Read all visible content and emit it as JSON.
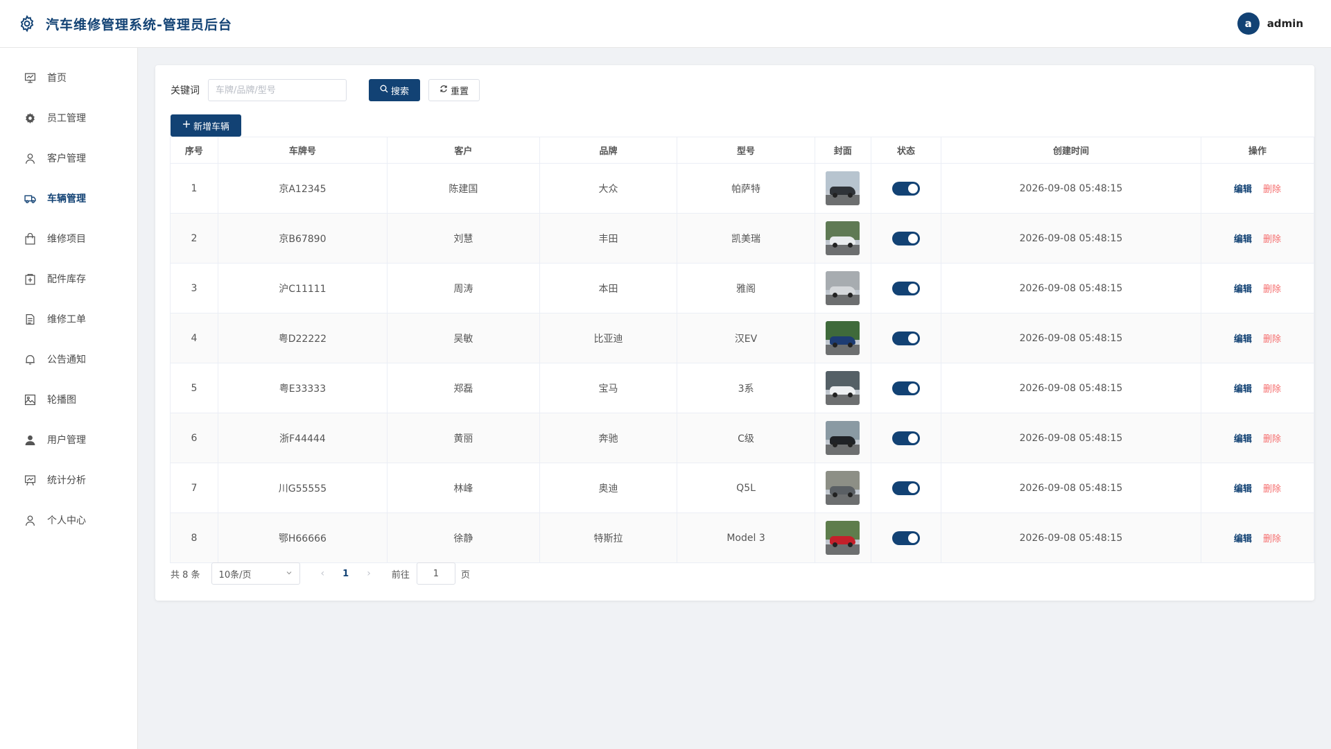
{
  "header": {
    "title": "汽车维修管理系统-管理员后台",
    "avatar_letter": "a",
    "username": "admin"
  },
  "sidebar": {
    "items": [
      {
        "label": "首页",
        "icon": "dashboard-icon",
        "active": false
      },
      {
        "label": "员工管理",
        "icon": "gear-icon",
        "active": false
      },
      {
        "label": "客户管理",
        "icon": "person-icon",
        "active": false
      },
      {
        "label": "车辆管理",
        "icon": "truck-icon",
        "active": true
      },
      {
        "label": "维修项目",
        "icon": "bag-icon",
        "active": false
      },
      {
        "label": "配件库存",
        "icon": "box-icon",
        "active": false
      },
      {
        "label": "维修工单",
        "icon": "document-icon",
        "active": false
      },
      {
        "label": "公告通知",
        "icon": "bell-icon",
        "active": false
      },
      {
        "label": "轮播图",
        "icon": "image-icon",
        "active": false
      },
      {
        "label": "用户管理",
        "icon": "user-filled-icon",
        "active": false
      },
      {
        "label": "统计分析",
        "icon": "chart-board-icon",
        "active": false
      },
      {
        "label": "个人中心",
        "icon": "person-icon",
        "active": false
      }
    ]
  },
  "search": {
    "label": "关键词",
    "placeholder": "车牌/品牌/型号",
    "search_button": "搜索",
    "reset_button": "重置",
    "add_button": "新增车辆"
  },
  "table": {
    "columns": [
      "序号",
      "车牌号",
      "客户",
      "品牌",
      "型号",
      "封面",
      "状态",
      "创建时间",
      "操作"
    ],
    "rows": [
      {
        "no": "1",
        "plate": "京A12345",
        "customer": "陈建国",
        "brand": "大众",
        "model": "帕萨特",
        "status": true,
        "created": "2026-09-08 05:48:15",
        "car_color": "#2f3338",
        "sky": "#b7c4cf"
      },
      {
        "no": "2",
        "plate": "京B67890",
        "customer": "刘慧",
        "brand": "丰田",
        "model": "凯美瑞",
        "status": true,
        "created": "2026-09-08 05:48:15",
        "car_color": "#e9ecee",
        "sky": "#5f7a54"
      },
      {
        "no": "3",
        "plate": "沪C11111",
        "customer": "周涛",
        "brand": "本田",
        "model": "雅阁",
        "status": true,
        "created": "2026-09-08 05:48:15",
        "car_color": "#d5d8db",
        "sky": "#a7acb0"
      },
      {
        "no": "4",
        "plate": "粤D22222",
        "customer": "吴敏",
        "brand": "比亚迪",
        "model": "汉EV",
        "status": true,
        "created": "2026-09-08 05:48:15",
        "car_color": "#1d3c73",
        "sky": "#3f6a3b"
      },
      {
        "no": "5",
        "plate": "粤E33333",
        "customer": "郑磊",
        "brand": "宝马",
        "model": "3系",
        "status": true,
        "created": "2026-09-08 05:48:15",
        "car_color": "#eef0f2",
        "sky": "#556066"
      },
      {
        "no": "6",
        "plate": "浙F44444",
        "customer": "黄丽",
        "brand": "奔驰",
        "model": "C级",
        "status": true,
        "created": "2026-09-08 05:48:15",
        "car_color": "#1f2226",
        "sky": "#8a9aa3"
      },
      {
        "no": "7",
        "plate": "川G55555",
        "customer": "林峰",
        "brand": "奥迪",
        "model": "Q5L",
        "status": true,
        "created": "2026-09-08 05:48:15",
        "car_color": "#5a5f64",
        "sky": "#8d8f86"
      },
      {
        "no": "8",
        "plate": "鄂H66666",
        "customer": "徐静",
        "brand": "特斯拉",
        "model": "Model 3",
        "status": true,
        "created": "2026-09-08 05:48:15",
        "car_color": "#c4202a",
        "sky": "#5e7d4c"
      }
    ],
    "edit_label": "编辑",
    "delete_label": "删除"
  },
  "pagination": {
    "total_text": "共 8 条",
    "page_size": "10条/页",
    "current_page": "1",
    "goto_label": "前往",
    "goto_value": "1",
    "page_suffix": "页"
  },
  "colors": {
    "primary": "#124274",
    "danger": "#f56c6c"
  }
}
